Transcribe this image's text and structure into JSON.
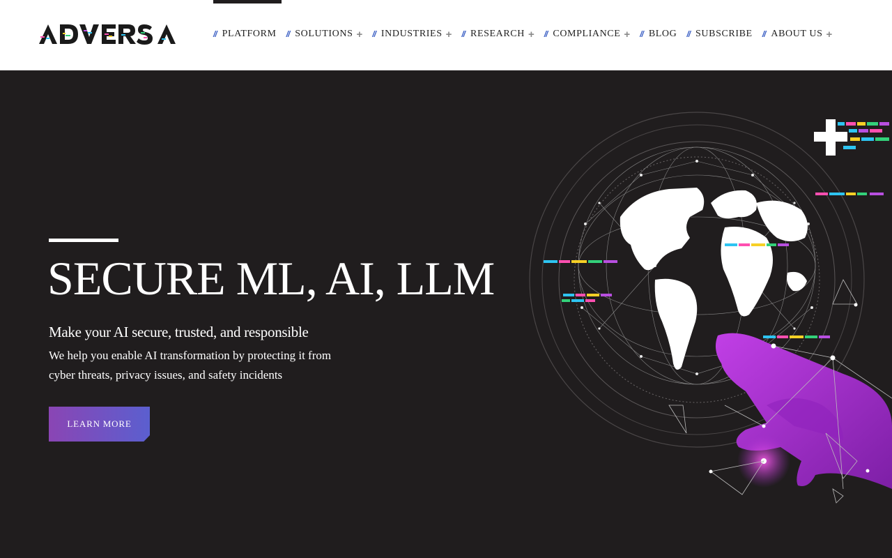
{
  "header": {
    "logo_text": "ADVERSA",
    "nav": [
      {
        "label": "PLATFORM",
        "has_submenu": false
      },
      {
        "label": "SOLUTIONS",
        "has_submenu": true
      },
      {
        "label": "INDUSTRIES",
        "has_submenu": true
      },
      {
        "label": "RESEARCH",
        "has_submenu": true
      },
      {
        "label": "COMPLIANCE",
        "has_submenu": true
      },
      {
        "label": "BLOG",
        "has_submenu": false
      },
      {
        "label": "SUBSCRIBE",
        "has_submenu": false
      },
      {
        "label": "ABOUT US",
        "has_submenu": true
      }
    ],
    "nav_separator": "//",
    "submenu_indicator": "+"
  },
  "hero": {
    "title": "SECURE ML, AI, LLM",
    "subtitle": "Make your AI secure, trusted, and responsible",
    "description": "We help you enable AI transformation by protecting it from cyber threats, privacy issues, and safety incidents",
    "cta_label": "LEARN MORE",
    "illustration": "globe-network-hand-icon"
  },
  "colors": {
    "background": "#201d1e",
    "header_bg": "#ffffff",
    "accent_blue": "#3b5fc4",
    "cta_gradient_start": "#8a45b4",
    "cta_gradient_end": "#5b5fcf",
    "hand_purple": "#a62fcf"
  }
}
